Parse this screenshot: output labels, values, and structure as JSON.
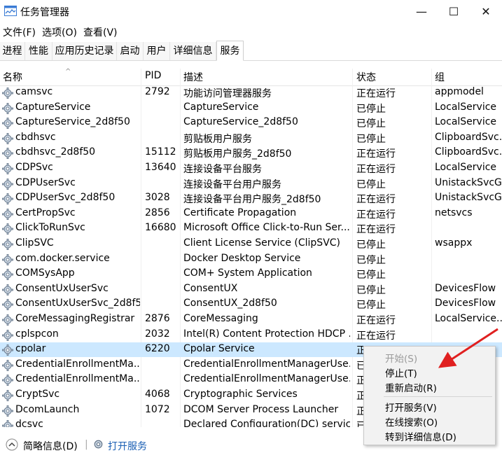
{
  "window": {
    "title": "任务管理器",
    "minimize": "—",
    "maximize": "☐",
    "close": "✕"
  },
  "menu": [
    "文件(F)",
    "选项(O)",
    "查看(V)"
  ],
  "tabs": [
    "进程",
    "性能",
    "应用历史记录",
    "启动",
    "用户",
    "详细信息",
    "服务"
  ],
  "active_tab": "服务",
  "columns": {
    "name": "名称",
    "pid": "PID",
    "desc": "描述",
    "status": "状态",
    "group": "组"
  },
  "rows": [
    {
      "name": "camsvc",
      "pid": "2792",
      "desc": "功能访问管理器服务",
      "status": "正在运行",
      "group": "appmodel"
    },
    {
      "name": "CaptureService",
      "pid": "",
      "desc": "CaptureService",
      "status": "已停止",
      "group": "LocalService"
    },
    {
      "name": "CaptureService_2d8f50",
      "pid": "",
      "desc": "CaptureService_2d8f50",
      "status": "已停止",
      "group": "LocalService"
    },
    {
      "name": "cbdhsvc",
      "pid": "",
      "desc": "剪贴板用户服务",
      "status": "已停止",
      "group": "ClipboardSvc..."
    },
    {
      "name": "cbdhsvc_2d8f50",
      "pid": "15112",
      "desc": "剪贴板用户服务_2d8f50",
      "status": "正在运行",
      "group": "ClipboardSvc..."
    },
    {
      "name": "CDPSvc",
      "pid": "13640",
      "desc": "连接设备平台服务",
      "status": "正在运行",
      "group": "LocalService"
    },
    {
      "name": "CDPUserSvc",
      "pid": "",
      "desc": "连接设备平台用户服务",
      "status": "已停止",
      "group": "UnistackSvcG..."
    },
    {
      "name": "CDPUserSvc_2d8f50",
      "pid": "3028",
      "desc": "连接设备平台用户服务_2d8f50",
      "status": "正在运行",
      "group": "UnistackSvcG..."
    },
    {
      "name": "CertPropSvc",
      "pid": "2856",
      "desc": "Certificate Propagation",
      "status": "正在运行",
      "group": "netsvcs"
    },
    {
      "name": "ClickToRunSvc",
      "pid": "16680",
      "desc": "Microsoft Office Click-to-Run Ser...",
      "status": "正在运行",
      "group": ""
    },
    {
      "name": "ClipSVC",
      "pid": "",
      "desc": "Client License Service (ClipSVC)",
      "status": "已停止",
      "group": "wsappx"
    },
    {
      "name": "com.docker.service",
      "pid": "",
      "desc": "Docker Desktop Service",
      "status": "已停止",
      "group": ""
    },
    {
      "name": "COMSysApp",
      "pid": "",
      "desc": "COM+ System Application",
      "status": "已停止",
      "group": ""
    },
    {
      "name": "ConsentUxUserSvc",
      "pid": "",
      "desc": "ConsentUX",
      "status": "已停止",
      "group": "DevicesFlow"
    },
    {
      "name": "ConsentUxUserSvc_2d8f50",
      "pid": "",
      "desc": "ConsentUX_2d8f50",
      "status": "已停止",
      "group": "DevicesFlow"
    },
    {
      "name": "CoreMessagingRegistrar",
      "pid": "2876",
      "desc": "CoreMessaging",
      "status": "正在运行",
      "group": "LocalService..."
    },
    {
      "name": "cplspcon",
      "pid": "2032",
      "desc": "Intel(R) Content Protection HDCP ...",
      "status": "正在运行",
      "group": ""
    },
    {
      "name": "cpolar",
      "pid": "6220",
      "desc": "Cpolar Service",
      "status": "正",
      "group": ""
    },
    {
      "name": "CredentialEnrollmentMa...",
      "pid": "",
      "desc": "CredentialEnrollmentManagerUse...",
      "status": "已",
      "group": ""
    },
    {
      "name": "CredentialEnrollmentMa...",
      "pid": "",
      "desc": "CredentialEnrollmentManagerUse...",
      "status": "正",
      "group": ""
    },
    {
      "name": "CryptSvc",
      "pid": "4068",
      "desc": "Cryptographic Services",
      "status": "正",
      "group": ""
    },
    {
      "name": "DcomLaunch",
      "pid": "1072",
      "desc": "DCOM Server Process Launcher",
      "status": "正",
      "group": ""
    },
    {
      "name": "dcsvc",
      "pid": "",
      "desc": "Declared Configuration(DC) service",
      "status": "已",
      "group": ""
    }
  ],
  "selected_row": "cpolar",
  "context_menu": [
    {
      "label": "开始(S)",
      "disabled": true
    },
    {
      "label": "停止(T)",
      "disabled": false
    },
    {
      "label": "重新启动(R)",
      "disabled": false
    },
    {
      "label": "打开服务(V)",
      "disabled": false
    },
    {
      "label": "在线搜索(O)",
      "disabled": false
    },
    {
      "label": "转到详细信息(D)",
      "disabled": false
    }
  ],
  "footer": {
    "summary": "简略信息(D)",
    "open_services": "打开服务"
  },
  "colors": {
    "selection": "#cce8ff",
    "annotation_arrow": "#e02020",
    "link": "#1a5fb4"
  },
  "icons": [
    "task-manager-icon",
    "gear-service-icon",
    "collapse-chevron-icon",
    "open-services-gear-icon",
    "annotation-arrow"
  ]
}
